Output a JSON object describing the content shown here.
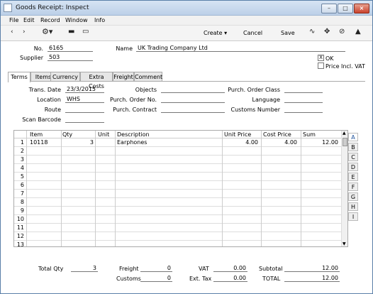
{
  "window": {
    "title": "Goods Receipt: Inspect"
  },
  "menu": [
    "File",
    "Edit",
    "Record",
    "Window",
    "Info"
  ],
  "toolbar": {
    "create": "Create",
    "cancel": "Cancel",
    "save": "Save"
  },
  "header": {
    "no_label": "No.",
    "no_value": "6165",
    "name_label": "Name",
    "name_value": "UK Trading Company Ltd",
    "supplier_label": "Supplier",
    "supplier_value": "503",
    "ok_label": "OK",
    "ok_checked": "X",
    "price_incl_vat_label": "Price Incl. VAT"
  },
  "tabs": [
    "Terms",
    "Items",
    "Currency",
    "Extra Costs",
    "Freight",
    "Comment"
  ],
  "terms": {
    "trans_date_label": "Trans. Date",
    "trans_date": "23/3/2015",
    "location_label": "Location",
    "location": "WHS",
    "route_label": "Route",
    "scan_barcode_label": "Scan Barcode",
    "objects_label": "Objects",
    "purch_order_no_label": "Purch. Order No.",
    "purch_contract_label": "Purch. Contract",
    "purch_order_class_label": "Purch. Order Class",
    "language_label": "Language",
    "customs_number_label": "Customs Number"
  },
  "grid": {
    "headers": [
      "Item",
      "Qty",
      "Unit",
      "Description",
      "Unit Price",
      "Cost Price",
      "Sum"
    ],
    "rows": [
      {
        "n": "1",
        "item": "10118",
        "qty": "3",
        "unit": "",
        "desc": "Earphones",
        "unit_price": "4.00",
        "cost_price": "4.00",
        "sum": "12.00"
      },
      {
        "n": "2"
      },
      {
        "n": "3"
      },
      {
        "n": "4"
      },
      {
        "n": "5"
      },
      {
        "n": "6"
      },
      {
        "n": "7"
      },
      {
        "n": "8"
      },
      {
        "n": "9"
      },
      {
        "n": "10"
      },
      {
        "n": "11"
      },
      {
        "n": "12"
      },
      {
        "n": "13"
      }
    ],
    "letters": [
      "A",
      "B",
      "C",
      "D",
      "E",
      "F",
      "G",
      "H",
      "I"
    ]
  },
  "footer": {
    "total_qty_label": "Total Qty",
    "total_qty": "3",
    "freight_label": "Freight",
    "freight": "0",
    "customs_label": "Customs",
    "customs": "0",
    "vat_label": "VAT",
    "vat": "0.00",
    "ext_tax_label": "Ext. Tax",
    "ext_tax": "0.00",
    "subtotal_label": "Subtotal",
    "subtotal": "12.00",
    "total_label": "TOTAL",
    "total": "12.00"
  }
}
